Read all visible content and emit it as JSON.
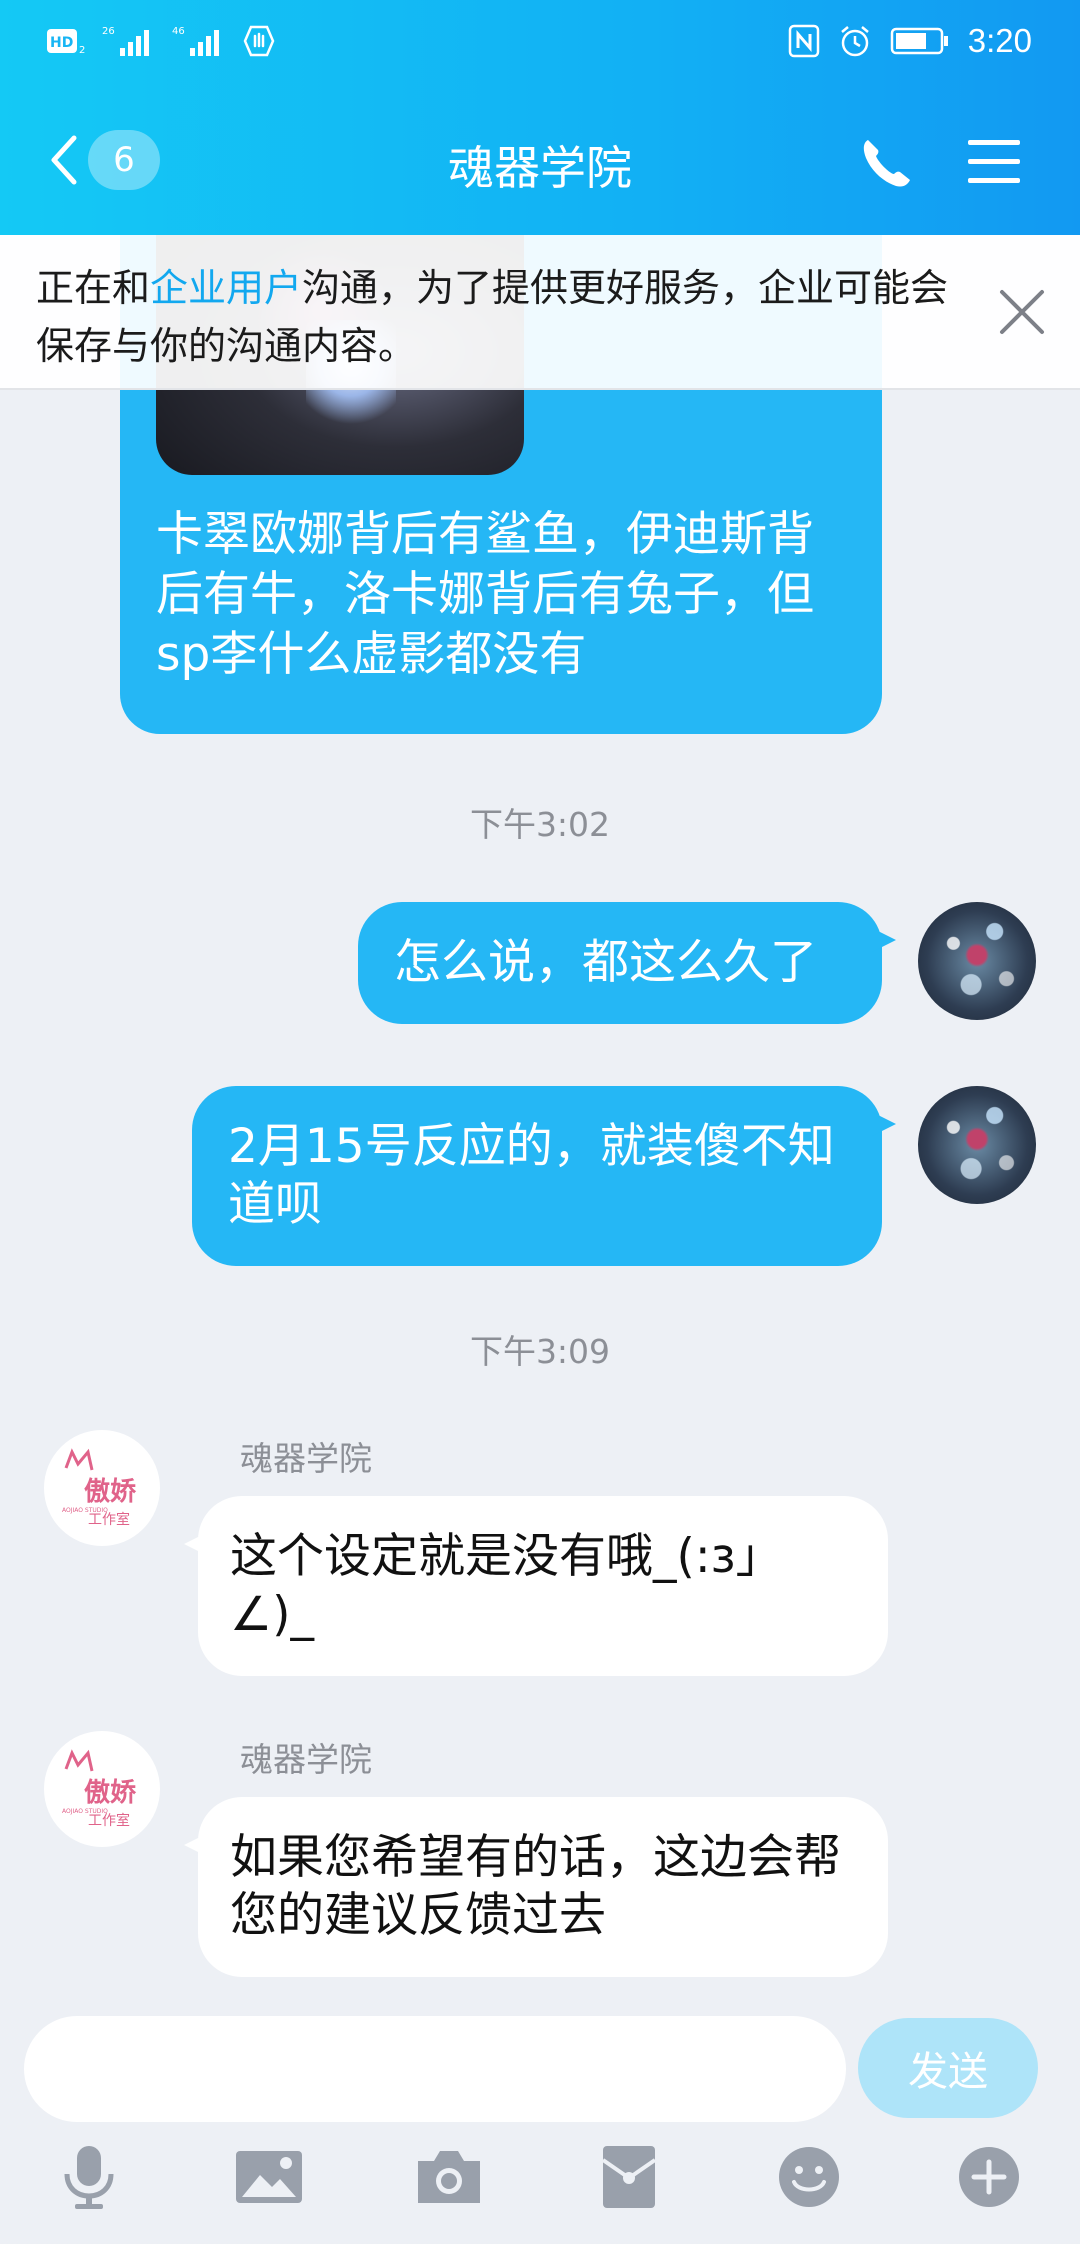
{
  "status_bar": {
    "network_left": "HD 2 26 46",
    "time": "3:20"
  },
  "header": {
    "back_badge": "6",
    "title": "魂器学院"
  },
  "notice": {
    "prefix": "正在和",
    "link": "企业用户",
    "suffix": "沟通，为了提供更好服务，企业可能会保存与你的沟通内容。"
  },
  "messages": {
    "top_card_text": "卡翠欧娜背后有鲨鱼，伊迪斯背后有牛，洛卡娜背后有兔子，但sp李什么虚影都没有",
    "time_1": "下午3:02",
    "out_1": "怎么说，都这么久了",
    "out_2": "2月15号反应的，就装傻不知道呗",
    "time_2": "下午3:09",
    "sender_1": "魂器学院",
    "in_1": "这个设定就是没有哦_(:з」∠)_",
    "sender_2": "魂器学院",
    "in_2": "如果您希望有的话，这边会帮您的建议反馈过去"
  },
  "avatar_logo": {
    "main": "傲娇",
    "sub": "工作室",
    "tiny": "AOJIAO STUDIO"
  },
  "input": {
    "value": "",
    "send_label": "发送"
  },
  "colors": {
    "header_gradient_start": "#14c9f5",
    "header_gradient_end": "#1299f2",
    "outgoing_bubble": "#25b7f5",
    "incoming_bubble": "#ffffff",
    "background": "#edf0f5",
    "link": "#12a8ef"
  },
  "icons": [
    "back-icon",
    "phone-icon",
    "menu-icon",
    "close-icon",
    "mic-icon",
    "image-icon",
    "camera-icon",
    "red-packet-icon",
    "emoji-icon",
    "plus-icon"
  ]
}
